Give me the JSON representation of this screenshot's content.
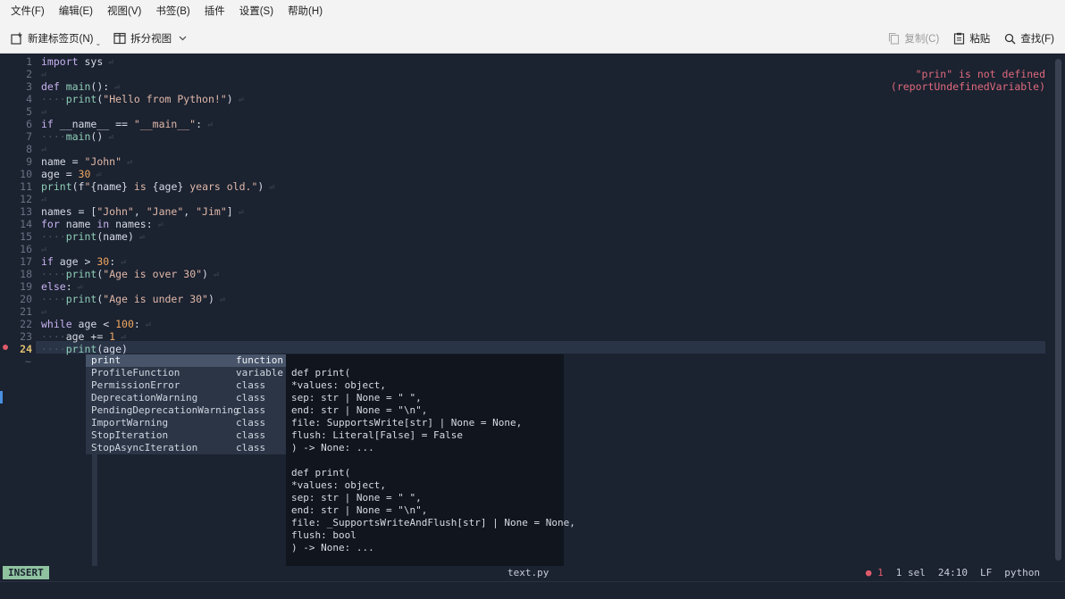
{
  "menu": [
    "文件(F)",
    "编辑(E)",
    "视图(V)",
    "书签(B)",
    "插件",
    "设置(S)",
    "帮助(H)"
  ],
  "toolbar": {
    "new_tab": "新建标签页(N)",
    "split_view": "拆分视图",
    "copy": "复制(C)",
    "paste": "粘贴",
    "find": "查找(F)"
  },
  "gutter": {
    "lines": [
      "1",
      "2",
      "3",
      "4",
      "5",
      "6",
      "7",
      "8",
      "9",
      "10",
      "11",
      "12",
      "13",
      "14",
      "15",
      "16",
      "17",
      "18",
      "19",
      "20",
      "21",
      "22",
      "23",
      "24"
    ],
    "tilde": "~"
  },
  "diagnostic": {
    "line1": "\"prin\" is not defined",
    "line2": "(reportUndefinedVariable)"
  },
  "completion": [
    {
      "name": "print",
      "kind": "function"
    },
    {
      "name": "ProfileFunction",
      "kind": "variable"
    },
    {
      "name": "PermissionError",
      "kind": "class"
    },
    {
      "name": "DeprecationWarning",
      "kind": "class"
    },
    {
      "name": "PendingDeprecationWarning",
      "kind": "class"
    },
    {
      "name": "ImportWarning",
      "kind": "class"
    },
    {
      "name": "StopIteration",
      "kind": "class"
    },
    {
      "name": "StopAsyncIteration",
      "kind": "class"
    }
  ],
  "doc": [
    "def print(",
    "*values: object,",
    "sep: str | None = \" \",",
    "end: str | None = \"\\n\",",
    "file: SupportsWrite[str] | None = None,",
    "flush: Literal[False] = False",
    ") -> None: ...",
    "",
    "def print(",
    "*values: object,",
    "sep: str | None = \" \",",
    "end: str | None = \"\\n\",",
    "file: _SupportsWriteAndFlush[str] | None = None,",
    "flush: bool",
    ") -> None: ..."
  ],
  "status": {
    "mode": "INSERT",
    "filename": "text.py",
    "errors": "● 1",
    "selections": "1 sel",
    "position": "24:10",
    "line_ending": "LF",
    "language": "python"
  },
  "colors": {
    "accent_error": "#e05a6a",
    "mode_bg": "#8fc3a0",
    "editor_bg": "#1b2230"
  }
}
